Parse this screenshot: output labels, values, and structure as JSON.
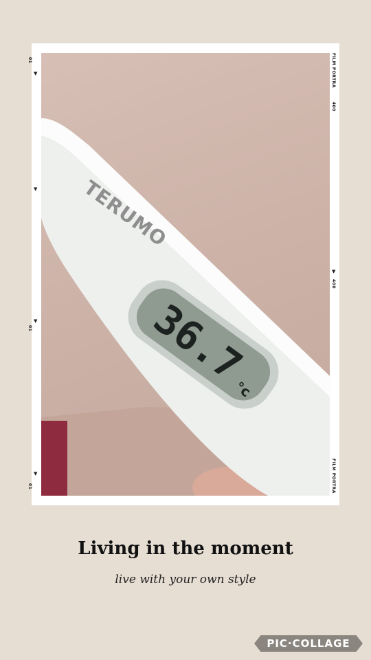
{
  "photo": {
    "thermometer_brand": "TERUMO",
    "thermometer_reading": "36.7",
    "thermometer_unit": "°c"
  },
  "film_marks": {
    "left_top": "01",
    "left_middle": "01",
    "left_bottom": "01",
    "right_top": "FILM PORTRA",
    "right_top_num": "400",
    "right_middle": "400",
    "right_bottom": "FILM PORTRA"
  },
  "caption": {
    "title": "Living in the moment",
    "subtitle": "live with your own style"
  },
  "watermark": "PIC·COLLAGE",
  "colors": {
    "background": "#e6ddd3",
    "frame": "#ffffff",
    "lcd": "#8f9a90"
  }
}
